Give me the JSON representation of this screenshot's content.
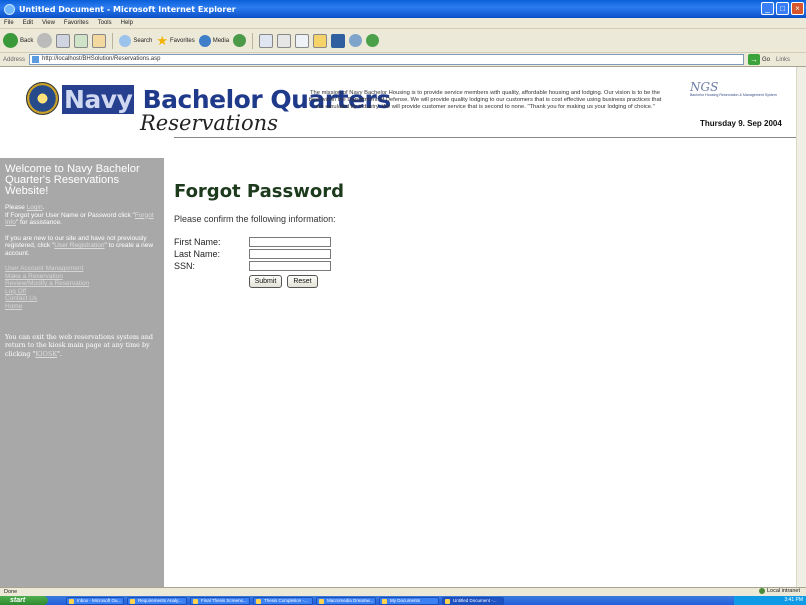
{
  "window": {
    "title": "Untitled Document - Microsoft Internet Explorer"
  },
  "menu": [
    "File",
    "Edit",
    "View",
    "Favorites",
    "Tools",
    "Help"
  ],
  "toolbar": {
    "back": "Back",
    "search": "Search",
    "favorites": "Favorites",
    "media": "Media"
  },
  "address": {
    "label": "Address",
    "url": "http://localhost/BHSolution/Reservations.asp",
    "go": "Go",
    "links": "Links"
  },
  "header": {
    "logo_main_navy": "Navy",
    "logo_main_rest": " Bachelor Quarters",
    "logo_sub": "Reservations",
    "mission": "The mission of Navy Bachelor Housing is to provide service members with quality, affordable housing and lodging. Our vision is to be the best within the Department of Defense. We will provide quality lodging to our customers that is cost effective using business practices that are emulated by industry. We will provide customer service that is second to none. \"Thank you for making us your lodging of choice.\"",
    "hrs_logo": "NGS",
    "hrs_subtitle": "Bachelor Housing Reservation & Management System",
    "date": "Thursday 9. Sep 2004"
  },
  "sidebar": {
    "welcome": "Welcome to Navy Bachelor Quarter's Reservations Website!",
    "login_prefix": "Please ",
    "login_link": "Login",
    "login_suffix": ".",
    "forgot_prefix": "If Forgot your User Name or Password click \"",
    "forgot_link": "Forgot Info",
    "forgot_suffix": "\" for assistance.",
    "new_prefix": "If you are new to our site and have not previously registered, click \"",
    "new_link": "User Registration",
    "new_suffix": "\" to create a new account.",
    "menu": [
      "User Account Management",
      "Make a Reservation",
      "Review/Modify a Reservation",
      "Log Off",
      "Contact Us",
      "Home"
    ],
    "kiosk_prefix": "You can exit the web reservations system and return to the kiosk main page at any time by clicking \"",
    "kiosk_link": "KIOSK",
    "kiosk_suffix": "\"."
  },
  "main": {
    "title": "Forgot Password",
    "instruction": "Please confirm the following information:",
    "fields": [
      {
        "label": "First Name:",
        "value": ""
      },
      {
        "label": "Last Name:",
        "value": ""
      },
      {
        "label": "SSN:",
        "value": ""
      }
    ],
    "submit": "Submit",
    "reset": "Reset"
  },
  "status": {
    "left": "Done",
    "zone": "Local intranet"
  },
  "taskbar": {
    "start": "start",
    "tasks": [
      "Inbox - Microsoft Ou...",
      "Requirements Analy...",
      "Final Thesis Screens...",
      "Thesis Completion -...",
      "Macromedia Dreamw...",
      "My Documents",
      "Untitled Document -..."
    ],
    "clock": "3:41 PM"
  }
}
